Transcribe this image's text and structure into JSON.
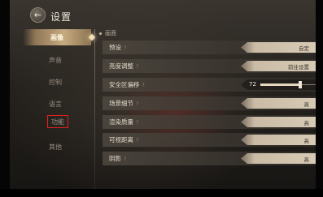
{
  "header": {
    "title": "设置",
    "back_icon": "back-arrow-icon"
  },
  "sidebar": {
    "tabs": [
      {
        "label": "画像",
        "active": true
      },
      {
        "label": "声音",
        "active": false
      },
      {
        "label": "控制",
        "active": false
      },
      {
        "label": "语言",
        "active": false
      },
      {
        "label": "功能",
        "active": false,
        "highlighted": true
      },
      {
        "label": "其他",
        "active": false
      }
    ]
  },
  "section": {
    "title": "画面"
  },
  "settings": [
    {
      "label": "预设",
      "help": "?",
      "value": "自定"
    },
    {
      "label": "亮度调整",
      "help": "?",
      "value": "前往设置"
    },
    {
      "label": "安全区偏移",
      "help": "?",
      "value": "72",
      "slider_fraction": 0.72
    },
    {
      "label": "场景细节",
      "help": "?",
      "value": "高"
    },
    {
      "label": "渲染质量",
      "help": "?",
      "value": "高"
    },
    {
      "label": "可视距离",
      "help": "?",
      "value": "高"
    },
    {
      "label": "阴影",
      "help": "?",
      "value": "高"
    }
  ],
  "colors": {
    "highlight_box": "#e02020",
    "active_tab": "#c7ab80"
  }
}
